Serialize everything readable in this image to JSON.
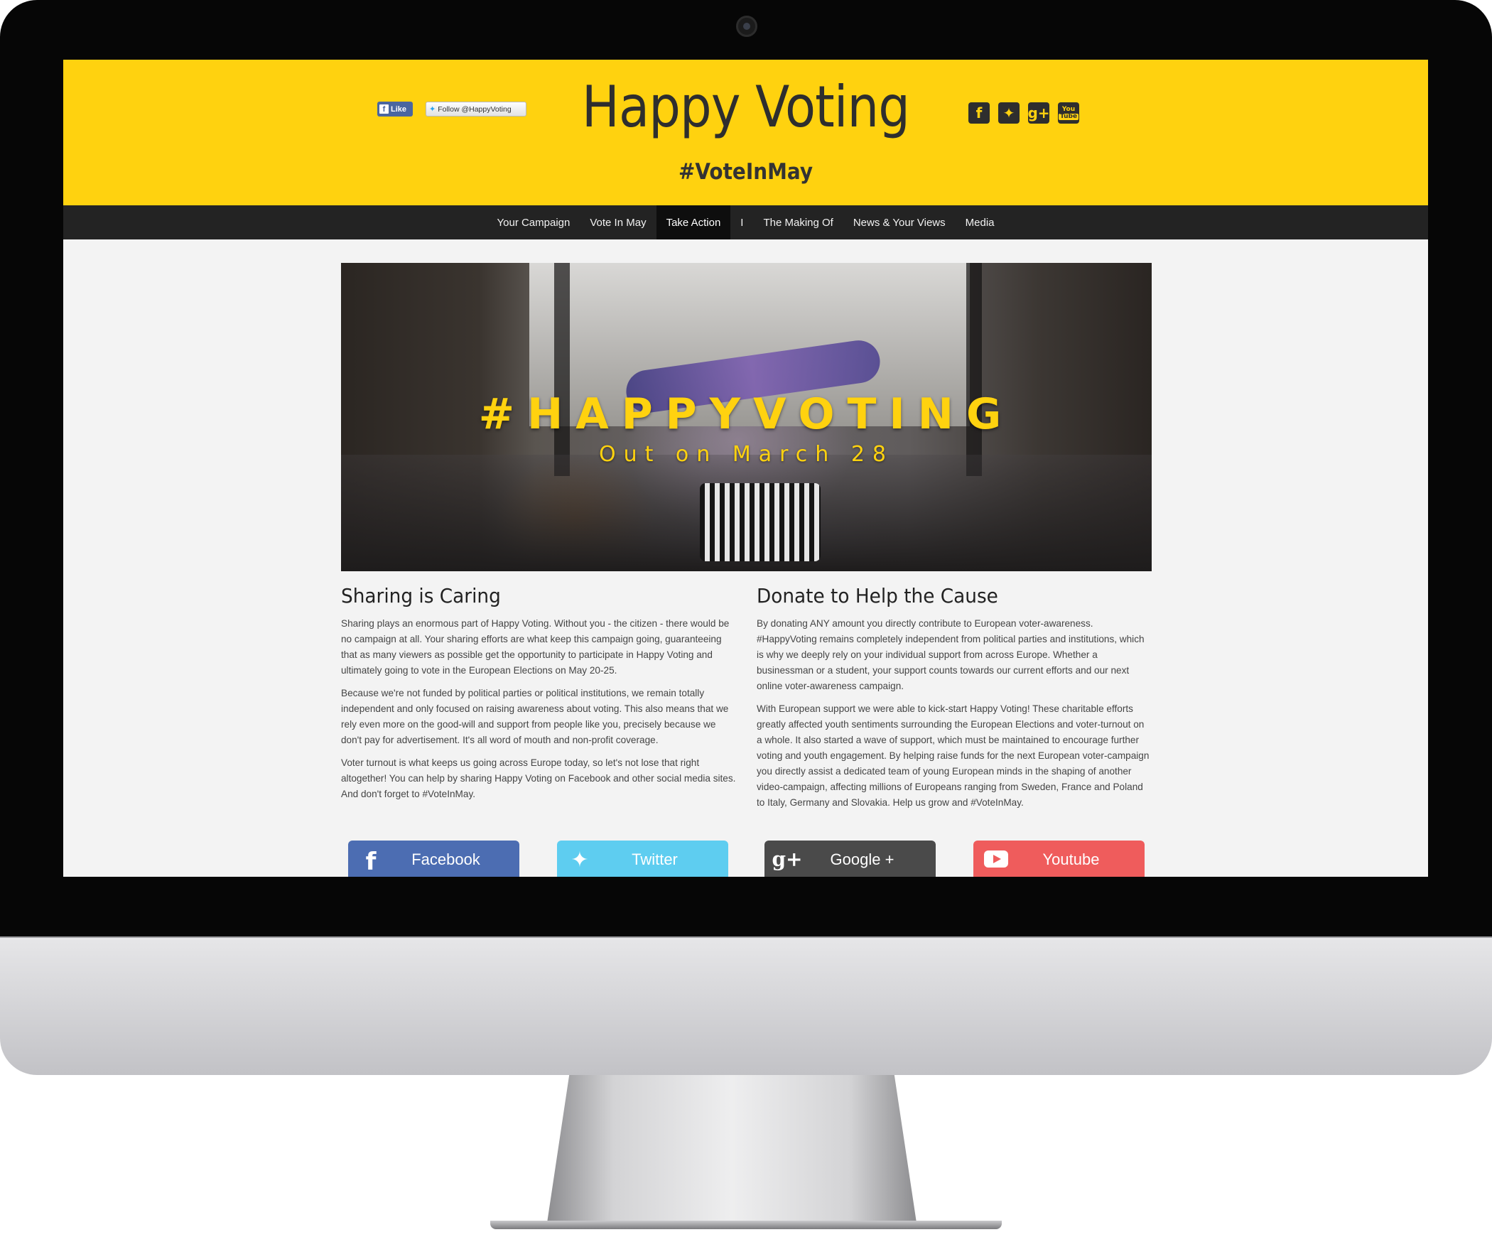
{
  "header": {
    "title": "Happy Voting",
    "subtitle": "#VoteInMay",
    "like_button": "Like",
    "follow_button": "Follow @HappyVoting",
    "social_icons": [
      "facebook-icon",
      "twitter-icon",
      "google-plus-icon",
      "youtube-icon"
    ],
    "youtube_icon_text": [
      "You",
      "Tube"
    ],
    "background_color": "#ffd20f"
  },
  "nav": {
    "items": [
      {
        "label": "Your Campaign",
        "active": false
      },
      {
        "label": "Vote In May",
        "active": false
      },
      {
        "label": "Take Action",
        "active": true
      },
      {
        "label": "I",
        "active": false
      },
      {
        "label": "The Making Of",
        "active": false
      },
      {
        "label": "News & Your Views",
        "active": false
      },
      {
        "label": "Media",
        "active": false
      }
    ]
  },
  "banner": {
    "headline": "#HAPPYVOTING",
    "subline": "Out on March 28"
  },
  "left_column": {
    "heading": "Sharing is Caring",
    "paragraphs": [
      "Sharing plays an enormous part of Happy Voting. Without you - the citizen - there would be no campaign at all. Your sharing efforts are what keep this campaign going, guaranteeing that as many viewers as possible get the opportunity to participate in Happy Voting and ultimately going to vote in the European Elections on May 20-25.",
      "Because we're not funded by political parties or political institutions, we remain totally independent and only focused on raising awareness about voting. This also means that we rely even more on the good-will and support from people like you, precisely because we don't pay for advertisement. It's all word of mouth and non-profit coverage.",
      "Voter turnout is what keeps us going across Europe today, so let's not lose that right altogether! You can help by sharing Happy Voting on Facebook and other social media sites. And don't forget to #VoteInMay."
    ]
  },
  "right_column": {
    "heading": "Donate to Help the Cause",
    "paragraphs": [
      "By donating ANY amount you directly contribute to European voter-awareness. #HappyVoting remains completely independent from political parties and institutions, which is why we deeply rely on your individual support from across Europe. Whether a businessman or a student, your support counts towards our current efforts and our next online voter-awareness campaign.",
      "With European support we were able to kick-start Happy Voting! These charitable efforts greatly affected youth sentiments surrounding the European Elections and voter-turnout on a whole. It also started a wave of support, which must be maintained to encourage further voting and youth engagement. By helping raise funds for the next European voter-campaign you directly assist a dedicated team of young European minds in the shaping of another video-campaign, affecting millions of Europeans ranging from Sweden, France and Poland to Italy, Germany and Slovakia. Help us grow and #VoteInMay."
    ]
  },
  "share_buttons": [
    {
      "label": "Facebook",
      "icon": "facebook-icon",
      "color": "#4c6db2"
    },
    {
      "label": "Twitter",
      "icon": "twitter-icon",
      "color": "#5ecdf0"
    },
    {
      "label": "Google +",
      "icon": "google-plus-icon",
      "color": "#4a4a4a"
    },
    {
      "label": "Youtube",
      "icon": "youtube-icon",
      "color": "#ef5c5c"
    }
  ]
}
